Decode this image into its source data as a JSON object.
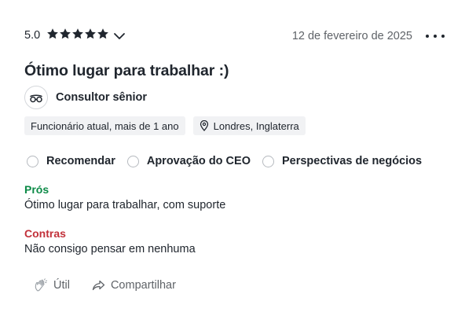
{
  "review": {
    "rating_value": "5.0",
    "stars_filled": 5,
    "stars_total": 5,
    "date": "12 de fevereiro de 2025",
    "title": "Ótimo lugar para trabalhar :)",
    "role": "Consultor sênior",
    "chips": {
      "employment": "Funcionário atual, mais de 1 ano",
      "location": "Londres, Inglaterra"
    },
    "badges": {
      "recommend": "Recomendar",
      "ceo": "Aprovação do CEO",
      "outlook": "Perspectivas de negócios"
    },
    "pros": {
      "label": "Prós",
      "text": "Ótimo lugar para trabalhar, com suporte"
    },
    "cons": {
      "label": "Contras",
      "text": "Não consigo pensar em nenhuma"
    },
    "actions": {
      "helpful": "Útil",
      "share": "Compartilhar"
    }
  },
  "colors": {
    "text": "#20262e",
    "muted": "#5f6368",
    "pros": "#0c8a47",
    "cons": "#c2313a",
    "chip_bg": "#f1f2f4"
  },
  "icons": {
    "stars": "star-icon",
    "expand": "chevron-down-icon",
    "more": "more-options-icon",
    "role": "glasses-mustache-icon",
    "location": "location-pin-icon",
    "helpful": "clap-hands-icon",
    "share": "share-arrow-icon"
  }
}
